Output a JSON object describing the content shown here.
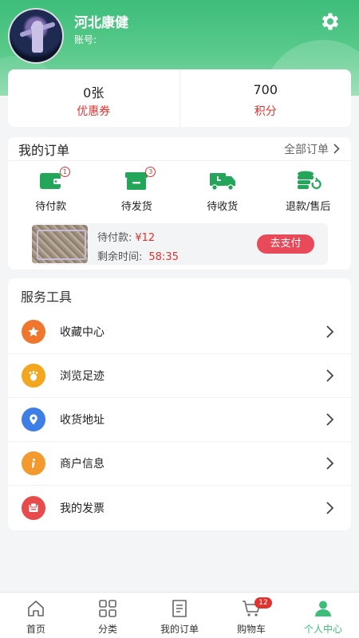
{
  "profile": {
    "name": "河北康健",
    "account_label": "账号:"
  },
  "stats": [
    {
      "value": "0张",
      "label": "优惠券"
    },
    {
      "value": "700",
      "label": "积分"
    }
  ],
  "orders": {
    "title": "我的订单",
    "all_label": "全部订单",
    "statuses": [
      {
        "label": "待付款",
        "badge": "1",
        "icon": "wallet-icon"
      },
      {
        "label": "待发货",
        "badge": "3",
        "icon": "package-icon"
      },
      {
        "label": "待收货",
        "badge": "",
        "icon": "truck-icon"
      },
      {
        "label": "退款/售后",
        "badge": "",
        "icon": "refund-icon"
      }
    ],
    "pending": {
      "amount_label": "待付款:",
      "amount": "¥12",
      "time_label": "剩余时间:",
      "time": "58:35",
      "pay_label": "去支付"
    }
  },
  "tools": {
    "title": "服务工具",
    "items": [
      {
        "label": "收藏中心",
        "icon": "star-icon",
        "color": "#f0752d"
      },
      {
        "label": "浏览足迹",
        "icon": "footprint-icon",
        "color": "#f3a61f"
      },
      {
        "label": "收货地址",
        "icon": "location-icon",
        "color": "#3d7fe6"
      },
      {
        "label": "商户信息",
        "icon": "info-icon",
        "color": "#f39a2e"
      },
      {
        "label": "我的发票",
        "icon": "invoice-icon",
        "color": "#e74b4b"
      }
    ]
  },
  "tabbar": [
    {
      "label": "首页",
      "icon": "home-icon"
    },
    {
      "label": "分类",
      "icon": "category-icon"
    },
    {
      "label": "我的订单",
      "icon": "orders-icon"
    },
    {
      "label": "购物车",
      "icon": "cart-icon",
      "badge": "12"
    },
    {
      "label": "个人中心",
      "icon": "person-icon",
      "active": true
    }
  ],
  "colors": {
    "brand_green": "#3dbd7a",
    "accent_red": "#e0332f",
    "pay_button": "#e84a5a"
  }
}
